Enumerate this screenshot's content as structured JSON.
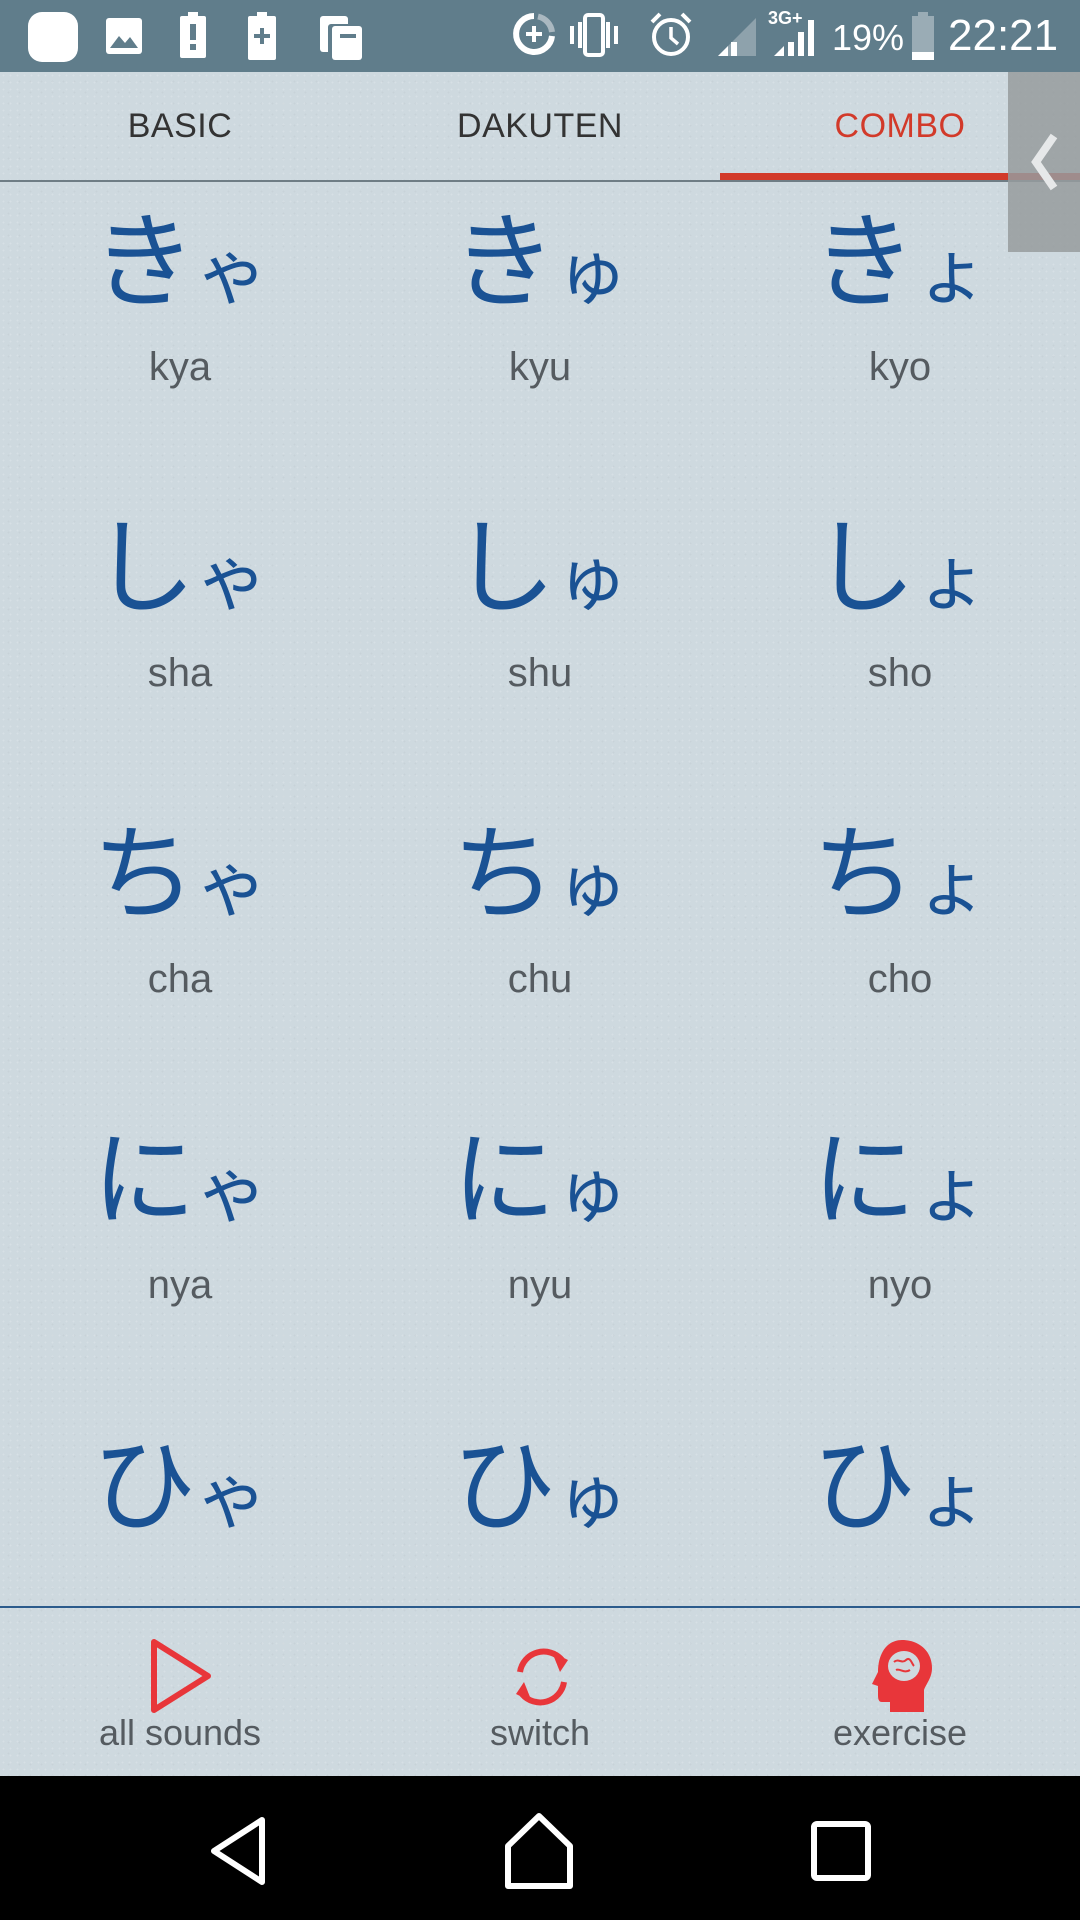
{
  "status_bar": {
    "left_icons": [
      "app-notification-icon",
      "image-icon",
      "battery-alert-icon",
      "battery-plus-icon",
      "book-icon"
    ],
    "right_icons": [
      "data-saver-icon",
      "vibrate-icon",
      "alarm-icon",
      "signal-icon",
      "signal-3g-icon",
      "battery-icon"
    ],
    "network_label": "3G+",
    "battery_percent": "19%",
    "time": "22:21"
  },
  "tabs": [
    {
      "label": "BASIC",
      "active": false
    },
    {
      "label": "DAKUTEN",
      "active": false
    },
    {
      "label": "COMBO",
      "active": true
    }
  ],
  "side_handle": {
    "icon": "chevron-left-icon"
  },
  "grid": [
    {
      "base": "き",
      "small": "ゃ",
      "romaji": "kya"
    },
    {
      "base": "き",
      "small": "ゅ",
      "romaji": "kyu"
    },
    {
      "base": "き",
      "small": "ょ",
      "romaji": "kyo"
    },
    {
      "base": "し",
      "small": "ゃ",
      "romaji": "sha"
    },
    {
      "base": "し",
      "small": "ゅ",
      "romaji": "shu"
    },
    {
      "base": "し",
      "small": "ょ",
      "romaji": "sho"
    },
    {
      "base": "ち",
      "small": "ゃ",
      "romaji": "cha"
    },
    {
      "base": "ち",
      "small": "ゅ",
      "romaji": "chu"
    },
    {
      "base": "ち",
      "small": "ょ",
      "romaji": "cho"
    },
    {
      "base": "に",
      "small": "ゃ",
      "romaji": "nya"
    },
    {
      "base": "に",
      "small": "ゅ",
      "romaji": "nyu"
    },
    {
      "base": "に",
      "small": "ょ",
      "romaji": "nyo"
    },
    {
      "base": "ひ",
      "small": "ゃ",
      "romaji": ""
    },
    {
      "base": "ひ",
      "small": "ゅ",
      "romaji": ""
    },
    {
      "base": "ひ",
      "small": "ょ",
      "romaji": ""
    }
  ],
  "bottom_bar": [
    {
      "label": "all sounds",
      "icon": "play-icon"
    },
    {
      "label": "switch",
      "icon": "refresh-icon"
    },
    {
      "label": "exercise",
      "icon": "brain-head-icon"
    }
  ],
  "nav_bar": [
    "back-button",
    "home-button",
    "recents-button"
  ],
  "colors": {
    "accent": "#d23a2a",
    "kana": "#1a5294",
    "icon_red": "#e8363a",
    "status_bar": "#607d8b"
  }
}
